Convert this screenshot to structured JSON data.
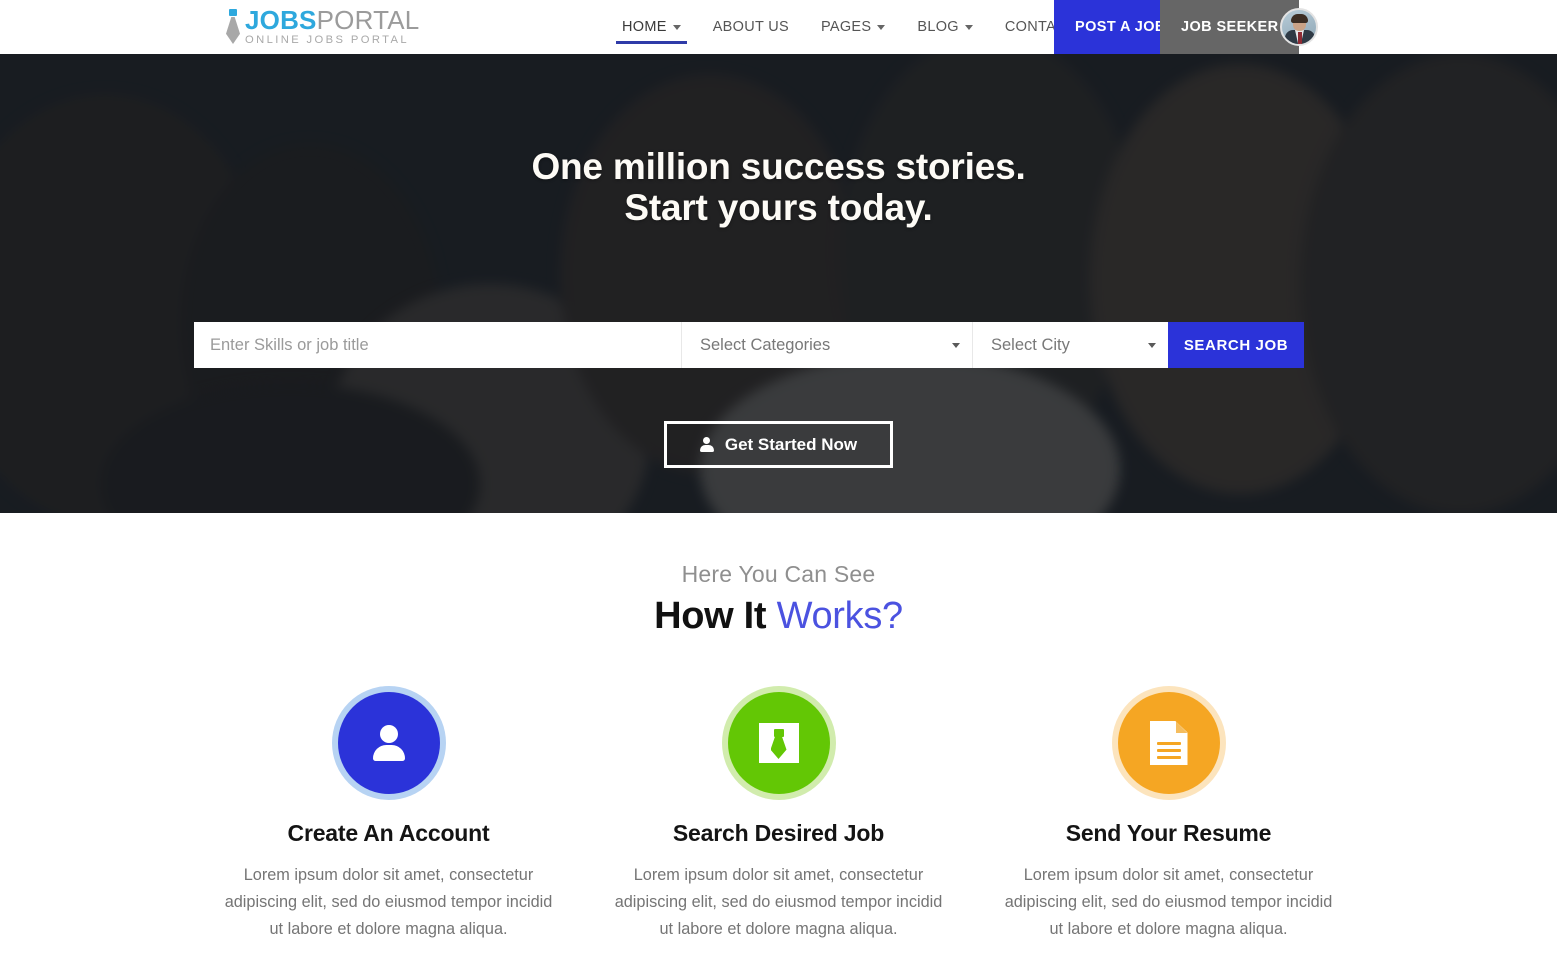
{
  "header": {
    "logo": {
      "icon": "tie-icon",
      "primary": "JOBS",
      "secondary": "PORTAL",
      "tagline": "ONLINE JOBS PORTAL"
    },
    "nav": [
      {
        "label": "HOME",
        "has_caret": true,
        "active": true
      },
      {
        "label": "ABOUT US",
        "has_caret": false,
        "active": false
      },
      {
        "label": "PAGES",
        "has_caret": true,
        "active": false
      },
      {
        "label": "BLOG",
        "has_caret": true,
        "active": false
      },
      {
        "label": "CONTACT",
        "has_caret": false,
        "active": false
      }
    ],
    "post_job_label": "POST A JOB",
    "job_seeker_label": "JOB SEEKER",
    "avatar_alt": "user-avatar",
    "accent_blue": "#2b33d9",
    "seeker_gray": "#666666",
    "active_underline": "#2f3ba8"
  },
  "hero": {
    "title_line1": "One million success stories.",
    "title_line2": "Start yours today.",
    "search": {
      "keyword_placeholder": "Enter Skills or job title",
      "keyword_value": "",
      "category_selected": "Select Categories",
      "city_selected": "Select City",
      "button_label": "SEARCH JOB"
    },
    "cta_label": "Get Started Now",
    "cta_icon": "user-icon"
  },
  "works": {
    "subtitle": "Here You Can See",
    "title_dark": "How It ",
    "title_accent": "Works?",
    "accent_color": "#4b52e0",
    "cards": [
      {
        "icon": "user-icon",
        "color": "#2b33d9",
        "title": "Create An Account",
        "desc": "Lorem ipsum dolor sit amet, consectetur adipiscing elit, sed do eiusmod tempor incidid ut labore et dolore magna aliqua."
      },
      {
        "icon": "tie-icon",
        "color": "#63c705",
        "title": "Search Desired Job",
        "desc": "Lorem ipsum dolor sit amet, consectetur adipiscing elit, sed do eiusmod tempor incidid ut labore et dolore magna aliqua."
      },
      {
        "icon": "document-icon",
        "color": "#f5a623",
        "title": "Send Your Resume",
        "desc": "Lorem ipsum dolor sit amet, consectetur adipiscing elit, sed do eiusmod tempor incidid ut labore et dolore magna aliqua."
      }
    ]
  }
}
